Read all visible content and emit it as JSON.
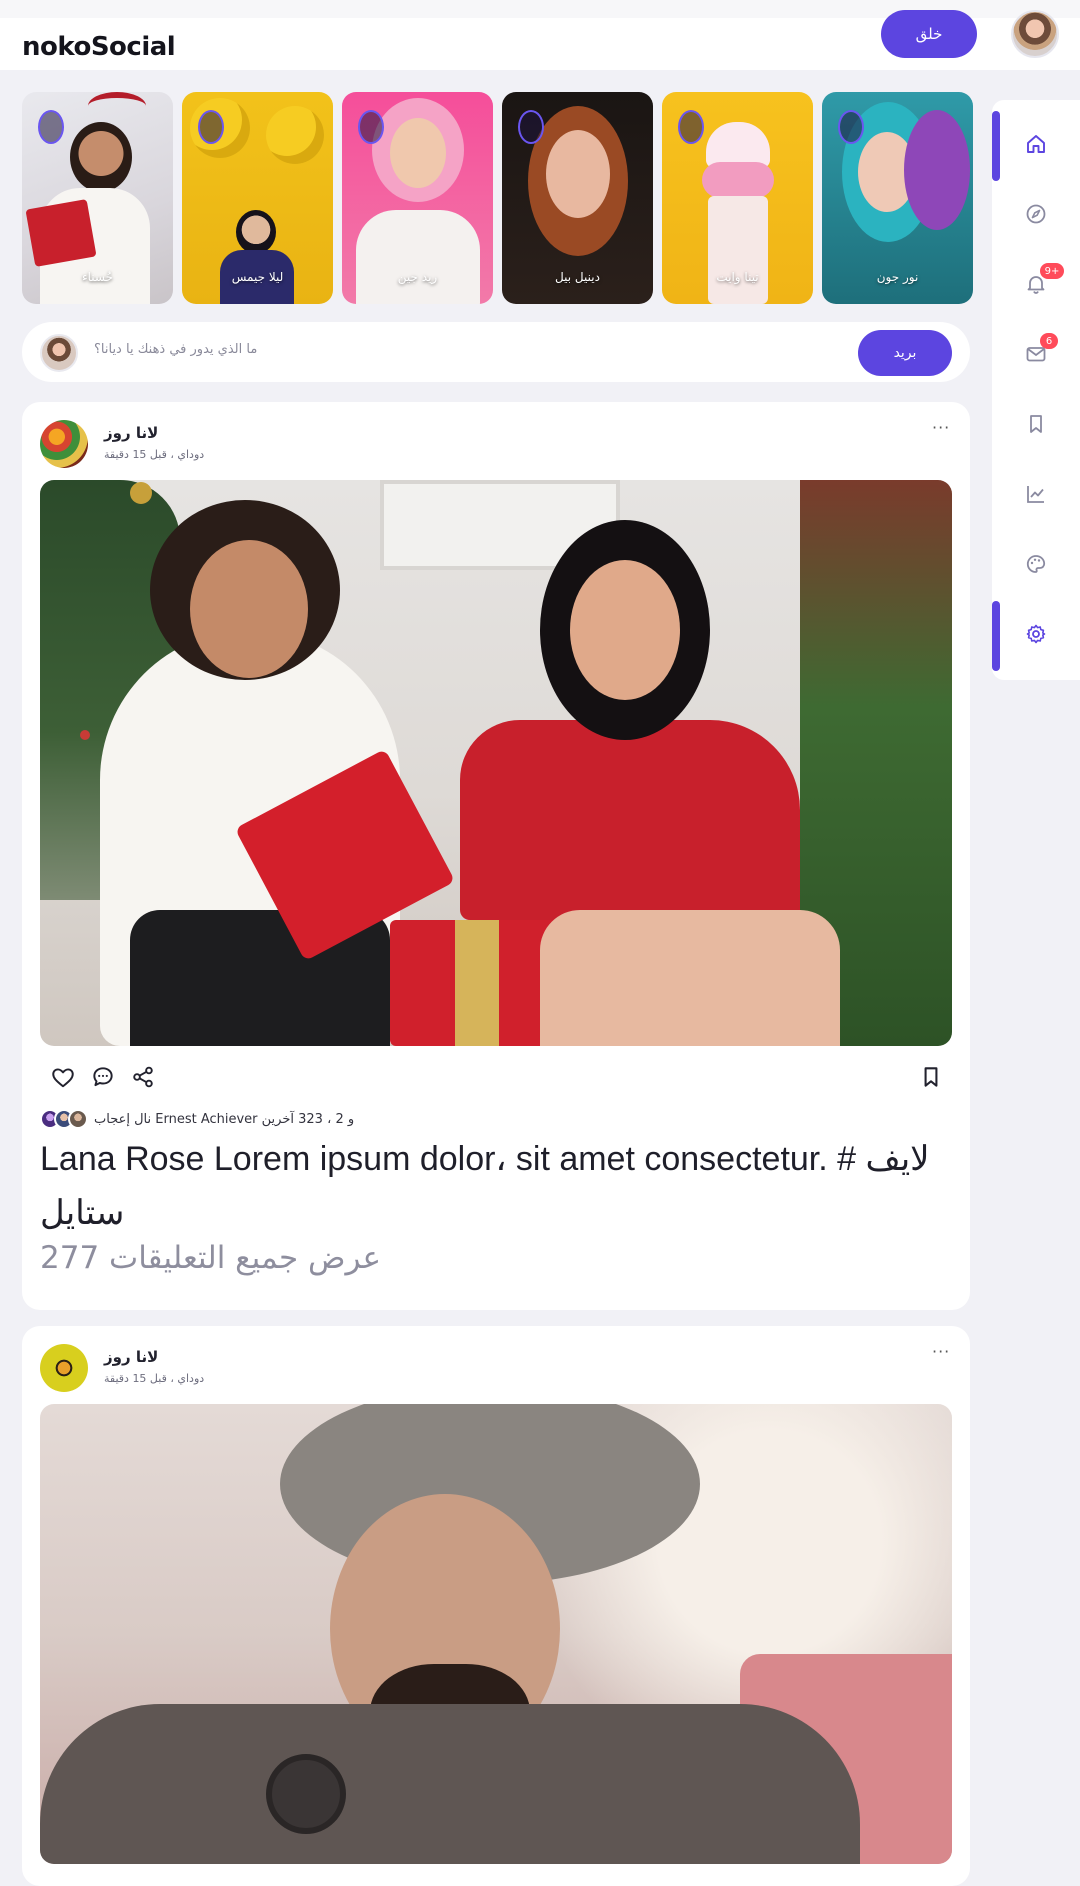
{
  "header": {
    "brand": "nokoSocial",
    "create_label": "خلق"
  },
  "stories": [
    {
      "name": "حُسناء"
    },
    {
      "name": "ليلا جيمس"
    },
    {
      "name": "ريد جين"
    },
    {
      "name": "دينيل بيل"
    },
    {
      "name": "تينا وايت"
    },
    {
      "name": "نور جون"
    }
  ],
  "composer": {
    "placeholder": "ما الذي يدور في ذهنك يا ديانا؟",
    "post_label": "بريد"
  },
  "posts": [
    {
      "author": "لانا روز",
      "meta": "دوداي ، قبل 15 دقيقة",
      "likes_text": "و 2 ، 323 آخرين Ernest Achiever نال إعجاب",
      "caption": "Lana Rose Lorem ipsum dolor، sit amet consectetur. # لايف ستايل",
      "view_all": "عرض جميع التعليقات 277"
    },
    {
      "author": "لانا روز",
      "meta": "دوداي ، قبل 15 دقيقة"
    }
  ],
  "sidebar": {
    "items": [
      {
        "icon": "home-icon"
      },
      {
        "icon": "compass-icon"
      },
      {
        "icon": "bell-icon",
        "badge": "9+"
      },
      {
        "icon": "mail-icon",
        "badge": "6"
      },
      {
        "icon": "bookmark-icon"
      },
      {
        "icon": "analytics-icon"
      },
      {
        "icon": "palette-icon"
      },
      {
        "icon": "settings-icon"
      }
    ]
  },
  "colors": {
    "accent": "#5c45e0",
    "badge": "#ff4b5a",
    "background": "#f1f1f6"
  }
}
